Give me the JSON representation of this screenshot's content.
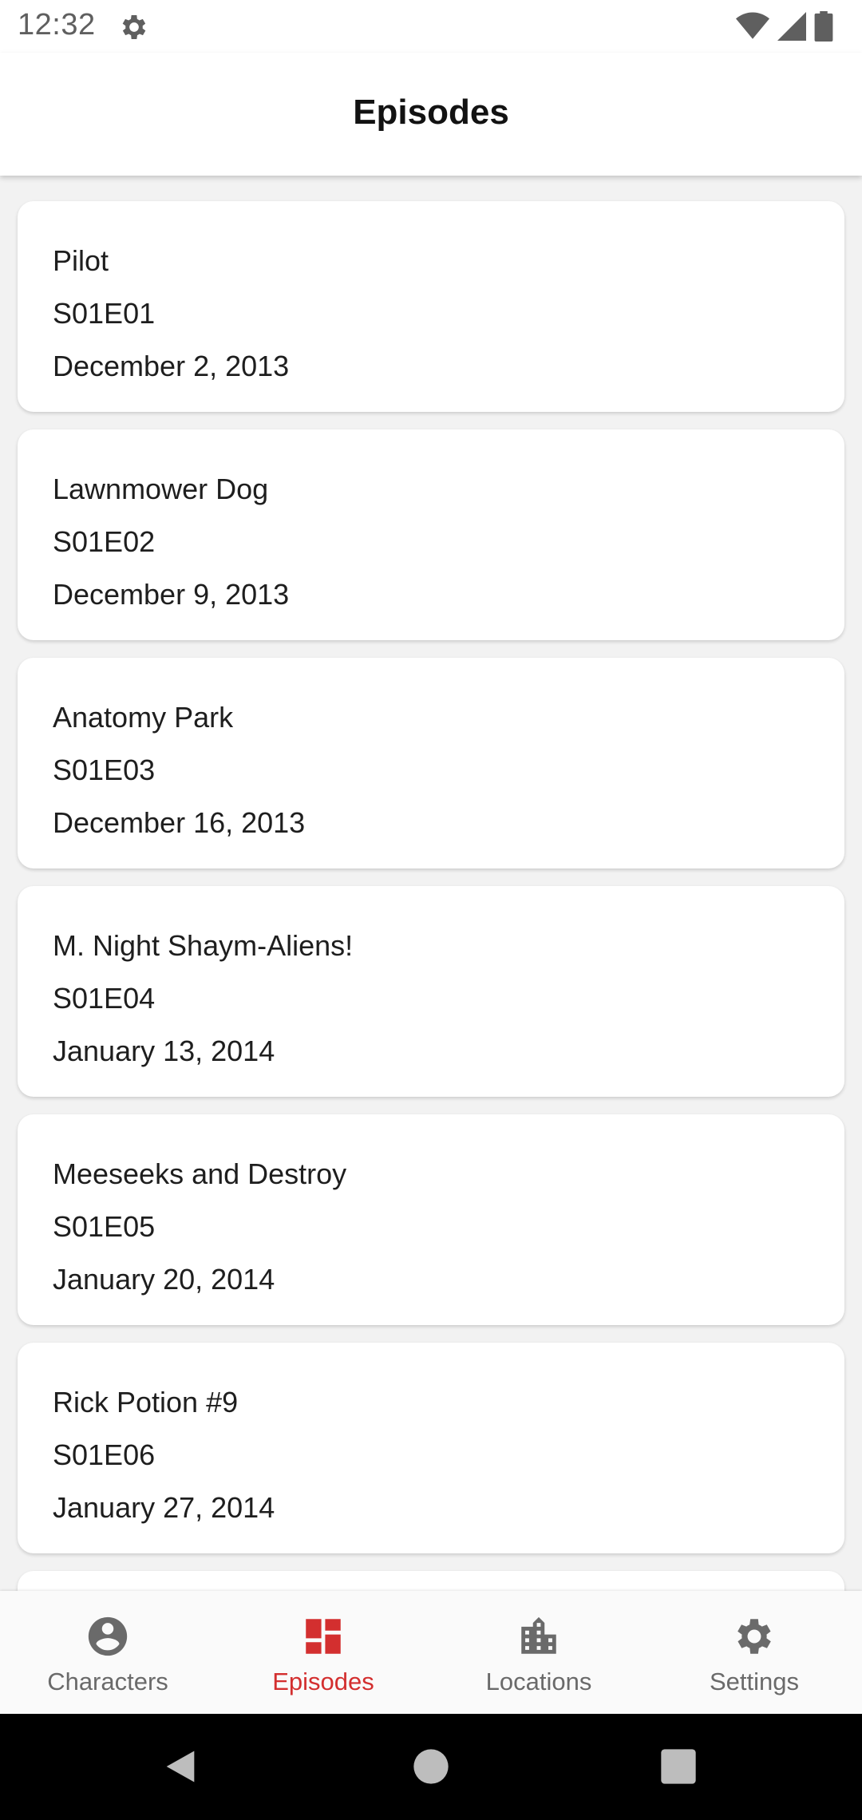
{
  "status_bar": {
    "time": "12:32"
  },
  "app_bar": {
    "title": "Episodes"
  },
  "episodes": [
    {
      "name": "Pilot",
      "code": "S01E01",
      "air_date": "December 2, 2013"
    },
    {
      "name": "Lawnmower Dog",
      "code": "S01E02",
      "air_date": "December 9, 2013"
    },
    {
      "name": "Anatomy Park",
      "code": "S01E03",
      "air_date": "December 16, 2013"
    },
    {
      "name": "M. Night Shaym-Aliens!",
      "code": "S01E04",
      "air_date": "January 13, 2014"
    },
    {
      "name": "Meeseeks and Destroy",
      "code": "S01E05",
      "air_date": "January 20, 2014"
    },
    {
      "name": "Rick Potion #9",
      "code": "S01E06",
      "air_date": "January 27, 2014"
    }
  ],
  "bottom_nav": {
    "items": [
      {
        "label": "Characters",
        "icon": "account-circle-icon"
      },
      {
        "label": "Episodes",
        "icon": "dashboard-icon",
        "active": true
      },
      {
        "label": "Locations",
        "icon": "city-icon"
      },
      {
        "label": "Settings",
        "icon": "gear-icon"
      }
    ]
  },
  "colors": {
    "accent": "#d32f2f",
    "inactive": "#6a6a6a",
    "card_background": "#ffffff",
    "page_background": "#f2f2f2"
  }
}
